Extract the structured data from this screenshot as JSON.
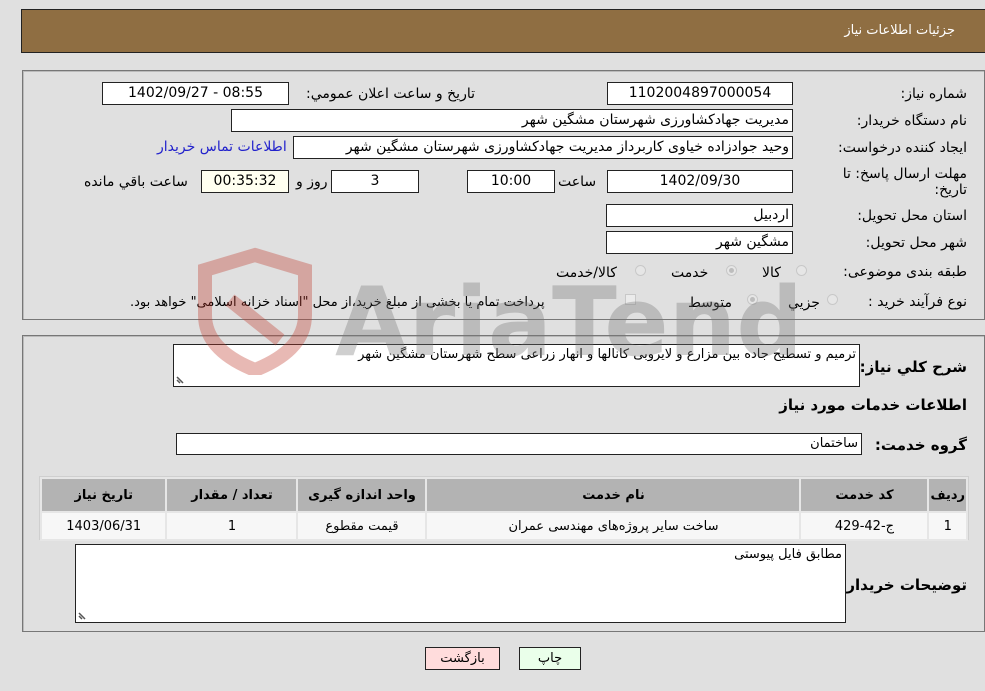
{
  "header": {
    "title": "جزئیات اطلاعات نیاز"
  },
  "details": {
    "need_number_label": "شماره نیاز:",
    "need_number": "1102004897000054",
    "announce_label": "تاريخ و ساعت اعلان عمومي:",
    "announce_value": "1402/09/27 - 08:55",
    "buyer_org_label": "نام دستگاه خریدار:",
    "buyer_org": "مدیریت جهادکشاورزی شهرستان مشگین شهر",
    "creator_label": "ایجاد کننده درخواست:",
    "creator": "وحید جوادزاده خیاوی کاربرداز مدیریت جهادکشاورزی شهرستان مشگین شهر",
    "contact_link": "اطلاعات تماس خریدار",
    "deadline_label_line1": "مهلت ارسال پاسخ: تا",
    "deadline_label_line2": "تاریخ:",
    "deadline_date": "1402/09/30",
    "time_label": "ساعت",
    "deadline_time": "10:00",
    "days_value": "3",
    "days_label": "روز و",
    "remaining_time": "00:35:32",
    "remaining_label": "ساعت باقي مانده",
    "province_label": "استان محل تحویل:",
    "province": "اردبیل",
    "city_label": "شهر محل تحویل:",
    "city": "مشگین شهر",
    "category_label": "طبقه بندی موضوعی:",
    "category_options": [
      {
        "label": "کالا",
        "checked": false
      },
      {
        "label": "خدمت",
        "checked": true
      },
      {
        "label": "کالا/خدمت",
        "checked": false
      }
    ],
    "process_label": "نوع فرآیند خرید :",
    "process_options": [
      {
        "label": "جزيي",
        "checked": false
      },
      {
        "label": "متوسط",
        "checked": true
      }
    ],
    "treasury_checkbox_label": "پرداخت تمام یا بخشی از مبلغ خرید،از محل \"اسناد خزانه اسلامی\" خواهد بود."
  },
  "services": {
    "summary_label": "شرح کلي نياز:",
    "summary": "ترمیم و تسطیح جاده بین مزارع و لایروبی کانالها و انهار زراعی سطح شهرستان مشگین شهر",
    "section_title": "اطلاعات خدمات مورد نیاز",
    "group_label": "گروه خدمت:",
    "group_value": "ساختمان",
    "table": {
      "headers": [
        "ردیف",
        "کد خدمت",
        "نام خدمت",
        "واحد اندازه گیری",
        "تعداد / مقدار",
        "تاریخ نیاز"
      ],
      "rows": [
        [
          "1",
          "ج-42-429",
          "ساخت سایر پروژه‌های مهندسی عمران",
          "قیمت مقطوع",
          "1",
          "1403/06/31"
        ]
      ]
    },
    "buyer_notes_label": "توضیحات خریدار:",
    "buyer_notes": "مطابق فایل پیوستی"
  },
  "buttons": {
    "print": "چاپ",
    "back": "بازگشت"
  },
  "colors": {
    "header_bg": "#8f6e42",
    "print_bg": "#eaffea",
    "back_bg": "#ffdcdc",
    "link": "#2222cc"
  },
  "watermark": {
    "text": "AriaTender.neT"
  }
}
